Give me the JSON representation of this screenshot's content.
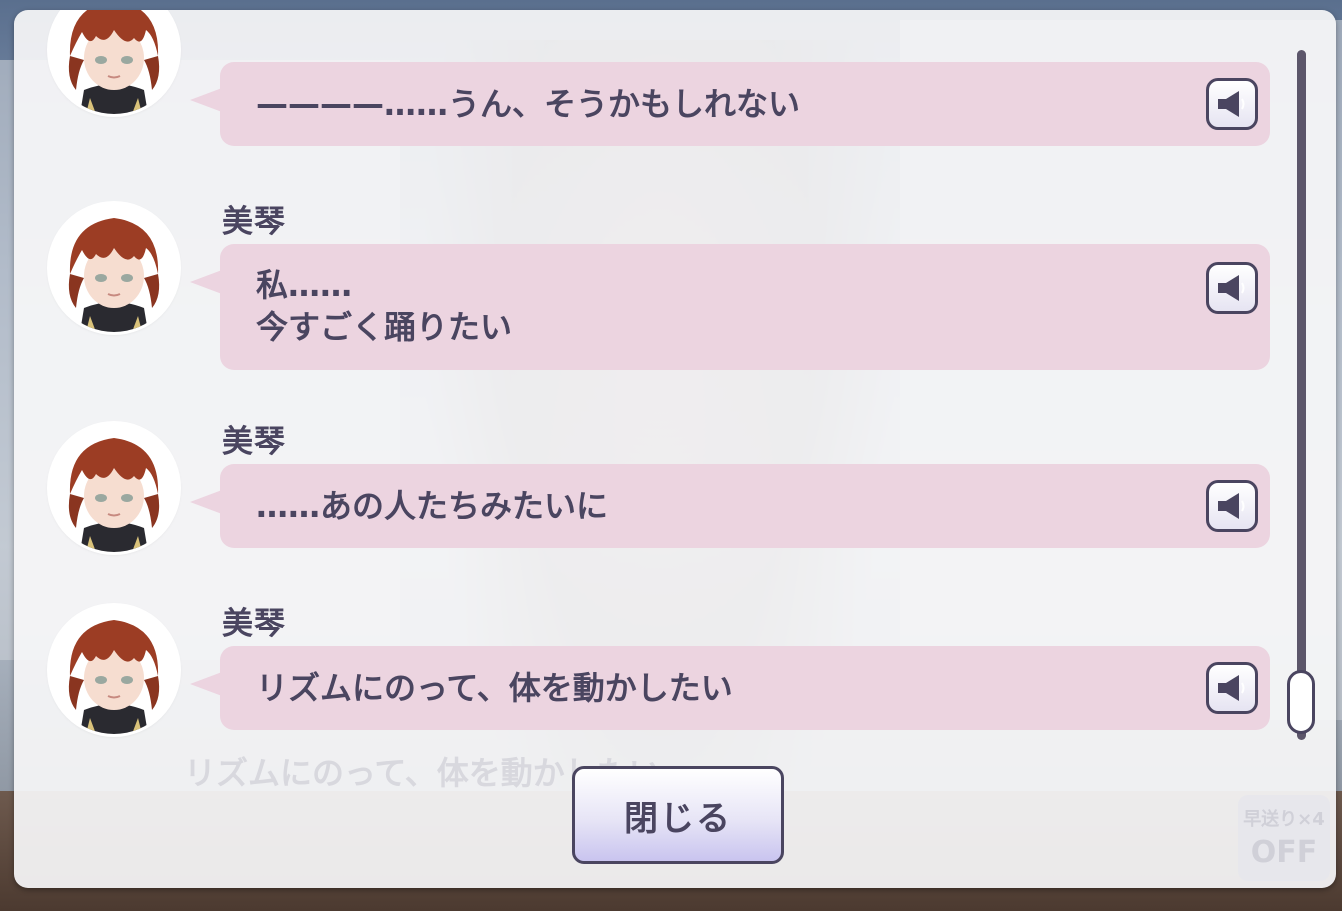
{
  "log": {
    "entries": [
      {
        "speaker": "",
        "text": "————……うん、そうかもしれない"
      },
      {
        "speaker": "美琴",
        "text": "私……\n今すごく踊りたい"
      },
      {
        "speaker": "美琴",
        "text": "……あの人たちみたいに"
      },
      {
        "speaker": "美琴",
        "text": "リズムにのって、体を動かしたい"
      }
    ]
  },
  "close_button": {
    "label": "閉じる"
  },
  "background": {
    "ghost_text": "リズムにのって、体を動かしたい",
    "fast_forward": {
      "label": "早送り×4",
      "value": "OFF"
    }
  },
  "colors": {
    "bubble": "#ecd4e0",
    "text": "#4a4560",
    "dialog": "#f6f6f8"
  },
  "icons": {
    "voice": "speaker-icon"
  }
}
